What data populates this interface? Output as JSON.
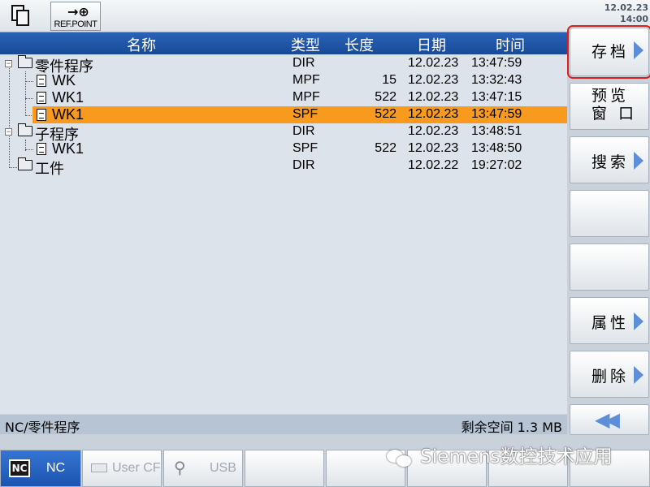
{
  "header": {
    "refpoint_label": "REF.POINT",
    "date": "12.02.23",
    "time": "14:00"
  },
  "columns": {
    "name": "名称",
    "type": "类型",
    "length": "长度",
    "date": "日期",
    "time": "时间"
  },
  "files": [
    {
      "name": "零件程序",
      "type": "DIR",
      "length": "",
      "date": "12.02.23",
      "time": "13:47:59",
      "kind": "folder"
    },
    {
      "name": "WK",
      "type": "MPF",
      "length": "15",
      "date": "12.02.23",
      "time": "13:32:43",
      "kind": "file"
    },
    {
      "name": "WK1",
      "type": "MPF",
      "length": "522",
      "date": "12.02.23",
      "time": "13:47:15",
      "kind": "file"
    },
    {
      "name": "WK1",
      "type": "SPF",
      "length": "522",
      "date": "12.02.23",
      "time": "13:47:59",
      "kind": "file",
      "selected": true
    },
    {
      "name": "子程序",
      "type": "DIR",
      "length": "",
      "date": "12.02.23",
      "time": "13:48:51",
      "kind": "folder"
    },
    {
      "name": "WK1",
      "type": "SPF",
      "length": "522",
      "date": "12.02.23",
      "time": "13:48:50",
      "kind": "file"
    },
    {
      "name": "工件",
      "type": "DIR",
      "length": "",
      "date": "12.02.22",
      "time": "19:27:02",
      "kind": "folder"
    }
  ],
  "status": {
    "path": "NC/零件程序",
    "free_space": "剩余空间 1.3 MB"
  },
  "vsoftkeys": {
    "archive": "存档",
    "preview_line1": "预览",
    "preview_line2": "窗 口",
    "search": "搜索",
    "properties": "属性",
    "delete": "删除"
  },
  "hsoftkeys": {
    "nc": "NC",
    "nc_badge": "NC",
    "user_cf": "User CF",
    "usb": "USB"
  },
  "watermark": "Siemens数控技术应用",
  "colors": {
    "header_blue": "#1f56a8",
    "selection_orange": "#f79a1d",
    "arrow_blue": "#5c8fd8",
    "highlight_red": "#e01c1c"
  }
}
